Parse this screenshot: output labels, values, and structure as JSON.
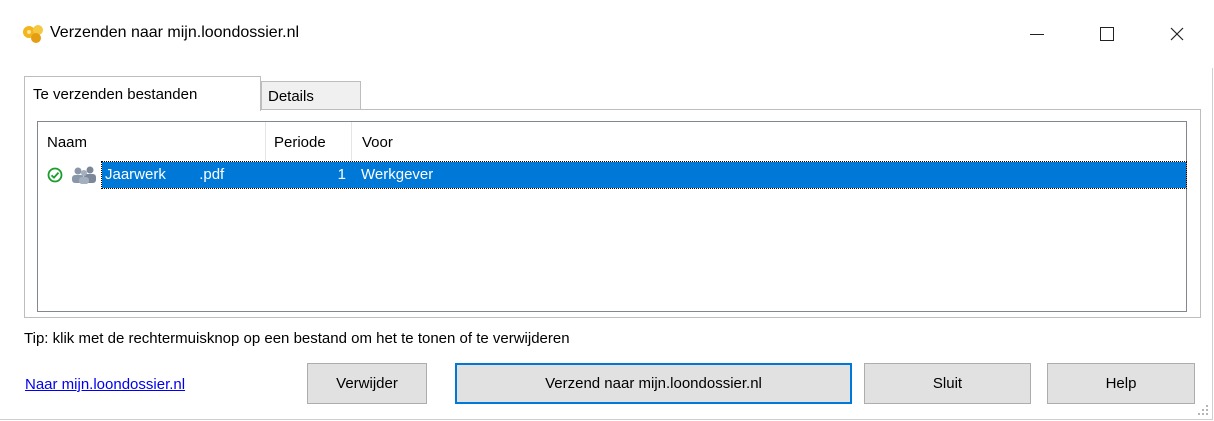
{
  "window": {
    "title": "Verzenden naar mijn.loondossier.nl",
    "app_icon": "loondossier-app-icon",
    "controls": [
      "minimize-icon",
      "maximize-icon",
      "close-icon"
    ]
  },
  "tabs": [
    {
      "label": "Te verzenden bestanden",
      "active": true
    },
    {
      "label": "Details",
      "active": false
    }
  ],
  "list": {
    "columns": [
      "Naam",
      "Periode",
      "Voor"
    ],
    "rows": [
      {
        "status_icon": "check-circle-icon",
        "type_icon": "users-icon",
        "naam": "Jaarwerk        .pdf",
        "periode": "1",
        "voor": "Werkgever",
        "selected": true
      }
    ]
  },
  "tip": "Tip: klik met de rechtermuisknop op een bestand om het te tonen of te verwijderen",
  "footer": {
    "link": "Naar mijn.loondossier.nl",
    "buttons": {
      "verwijder": "Verwijder",
      "verzend": "Verzend naar mijn.loondossier.nl",
      "sluit": "Sluit",
      "help": "Help"
    }
  },
  "colors": {
    "selection": "#0078d7",
    "link": "#0000ee",
    "check": "#1a9d2a"
  }
}
